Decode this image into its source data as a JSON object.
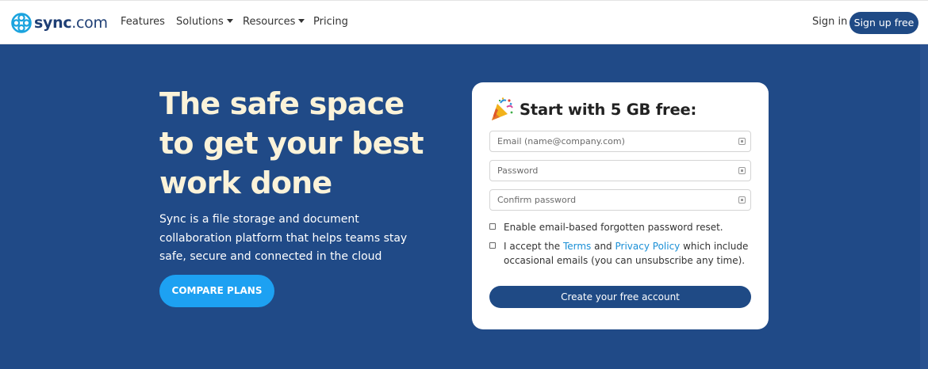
{
  "nav": {
    "logo_bold": "sync",
    "logo_suffix": ".com",
    "items": [
      {
        "label": "Features"
      },
      {
        "label": "Solutions"
      },
      {
        "label": "Resources"
      },
      {
        "label": "Pricing"
      }
    ],
    "sign_in": "Sign in",
    "sign_up": "Sign up free"
  },
  "hero": {
    "headline_lines": [
      "The safe space",
      "to get your best",
      "work done"
    ],
    "subtext": "Sync is a file storage and document collaboration platform that helps teams stay safe, secure and connected in the cloud",
    "compare_button": "COMPARE PLANS"
  },
  "signup": {
    "title": "Start with 5 GB free:",
    "email_placeholder": "Email (name@company.com)",
    "password_placeholder": "Password",
    "confirm_placeholder": "Confirm password",
    "reset_label": "Enable email-based forgotten password reset.",
    "accept_prefix": "I accept the ",
    "terms_link": "Terms",
    "and_text": " and ",
    "privacy_link": "Privacy Policy",
    "accept_suffix": " which include occasional emails (you can unsubscribe any time).",
    "submit": "Create your free account"
  },
  "colors": {
    "hero_bg": "#204a87",
    "primary_button": "#1f4a85",
    "compare_button": "#1da1f2",
    "headline": "#fbf3d9",
    "link": "#1a8fd6"
  },
  "icons": [
    "sync-logo-icon",
    "caret-down-icon",
    "party-popper-icon",
    "field-autofill-icon"
  ]
}
